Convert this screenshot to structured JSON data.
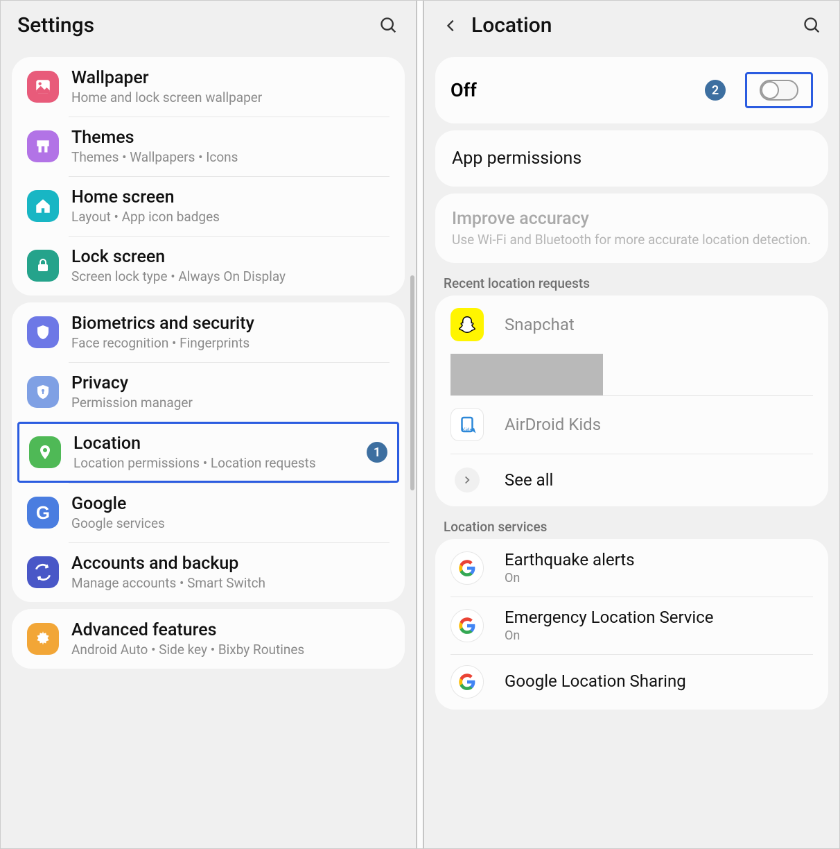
{
  "left": {
    "title": "Settings",
    "groups": [
      [
        {
          "icon": "wallpaper",
          "color": "#e85b7a",
          "title": "Wallpaper",
          "sub": "Home and lock screen wallpaper"
        },
        {
          "icon": "themes",
          "color": "#b273e6",
          "title": "Themes",
          "sub": "Themes  •  Wallpapers  •  Icons"
        },
        {
          "icon": "home",
          "color": "#18b6c4",
          "title": "Home screen",
          "sub": "Layout  •  App icon badges"
        },
        {
          "icon": "lock",
          "color": "#25a38b",
          "title": "Lock screen",
          "sub": "Screen lock type  •  Always On Display"
        }
      ],
      [
        {
          "icon": "shield",
          "color": "#6d78e6",
          "title": "Biometrics and security",
          "sub": "Face recognition  •  Fingerprints"
        },
        {
          "icon": "privacy",
          "color": "#7fa0e4",
          "title": "Privacy",
          "sub": "Permission manager"
        },
        {
          "icon": "location",
          "color": "#4fb956",
          "title": "Location",
          "sub": "Location permissions  •  Location requests",
          "badge": "1",
          "highlighted": true
        },
        {
          "icon": "google-g",
          "color": "#4a7de0",
          "title": "Google",
          "sub": "Google services"
        },
        {
          "icon": "accounts",
          "color": "#4957c7",
          "title": "Accounts and backup",
          "sub": "Manage accounts  •  Smart Switch"
        }
      ],
      [
        {
          "icon": "gear-adv",
          "color": "#f2a637",
          "title": "Advanced features",
          "sub": "Android Auto  •  Side key  •  Bixby Routines"
        }
      ]
    ]
  },
  "right": {
    "title": "Location",
    "toggle": {
      "label": "Off",
      "badge": "2",
      "on": false
    },
    "app_permissions": "App permissions",
    "improve": {
      "title": "Improve accuracy",
      "sub": "Use Wi-Fi and Bluetooth for more accurate location detection."
    },
    "recent_label": "Recent location requests",
    "recent": [
      {
        "icon": "snap",
        "name": "Snapchat"
      },
      {
        "redacted": true
      },
      {
        "icon": "airdroid",
        "name": "AirDroid Kids"
      }
    ],
    "see_all": "See all",
    "services_label": "Location services",
    "services": [
      {
        "title": "Earthquake alerts",
        "sub": "On"
      },
      {
        "title": "Emergency Location Service",
        "sub": "On"
      },
      {
        "title": "Google Location Sharing",
        "sub": ""
      }
    ]
  }
}
